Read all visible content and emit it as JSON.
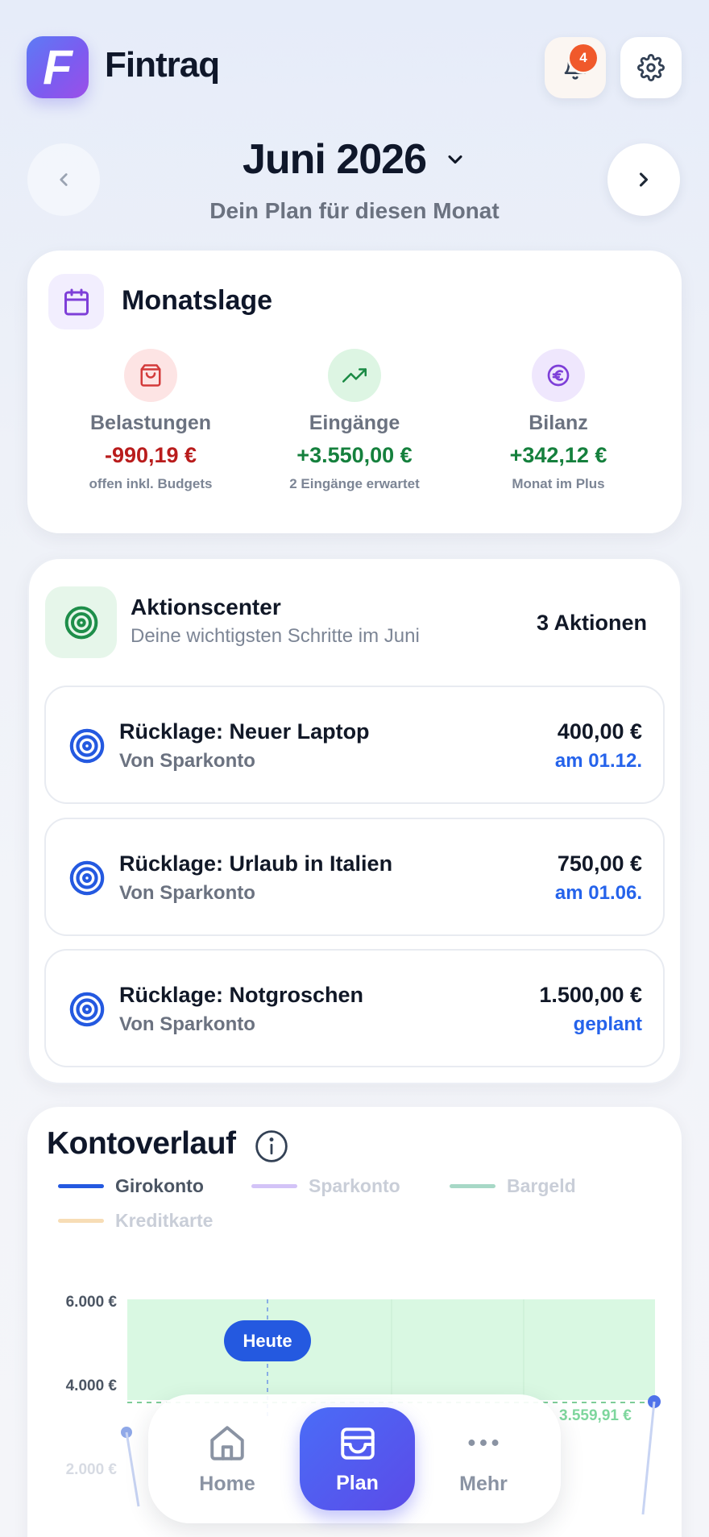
{
  "app": {
    "name": "Fintraq",
    "logo_letter": "F",
    "notification_count": "4"
  },
  "month": {
    "title": "Juni 2026",
    "subtitle": "Dein Plan für diesen Monat"
  },
  "overview": {
    "title": "Monatslage",
    "stats": [
      {
        "label": "Belastungen",
        "value": "-990,19 €",
        "note": "offen inkl. Budgets",
        "color": "#b91c1c",
        "icon": "shopping-bag-icon"
      },
      {
        "label": "Eingänge",
        "value": "+3.550,00 €",
        "note": "2 Eingänge erwartet",
        "color": "#15803d",
        "icon": "trend-up-icon"
      },
      {
        "label": "Bilanz",
        "value": "+342,12 €",
        "note": "Monat im Plus",
        "color": "#15803d",
        "icon": "euro-icon"
      }
    ]
  },
  "actions": {
    "title": "Aktionscenter",
    "subtitle": "Deine wichtigsten Schritte im Juni",
    "count": "3 Aktionen",
    "items": [
      {
        "title": "Rücklage: Neuer Laptop",
        "source": "Von Sparkonto",
        "amount": "400,00 €",
        "date": "am 01.12."
      },
      {
        "title": "Rücklage: Urlaub in Italien",
        "source": "Von Sparkonto",
        "amount": "750,00 €",
        "date": "am 01.06."
      },
      {
        "title": "Rücklage: Notgroschen",
        "source": "Von Sparkonto",
        "amount": "1.500,00 €",
        "date": "geplant"
      }
    ]
  },
  "chart": {
    "title": "Kontoverlauf",
    "today_label": "Heute",
    "end_value_label": "3.559,91 €"
  },
  "chart_data": {
    "type": "line",
    "ylim": [
      2000,
      6000
    ],
    "y_ticks": [
      "6.000 €",
      "4.000 €",
      "2.000 €"
    ],
    "series": [
      {
        "name": "Girokonto",
        "color": "#2459e0",
        "active": true
      },
      {
        "name": "Sparkonto",
        "color": "#d3c3f7",
        "active": false
      },
      {
        "name": "Bargeld",
        "color": "#a7d8c6",
        "active": false
      },
      {
        "name": "Kreditkarte",
        "color": "#f7ddb6",
        "active": false
      }
    ],
    "end_value": 3559.91
  },
  "bottom_nav": {
    "items": [
      {
        "label": "Home"
      },
      {
        "label": "Plan"
      },
      {
        "label": "Mehr"
      }
    ]
  }
}
